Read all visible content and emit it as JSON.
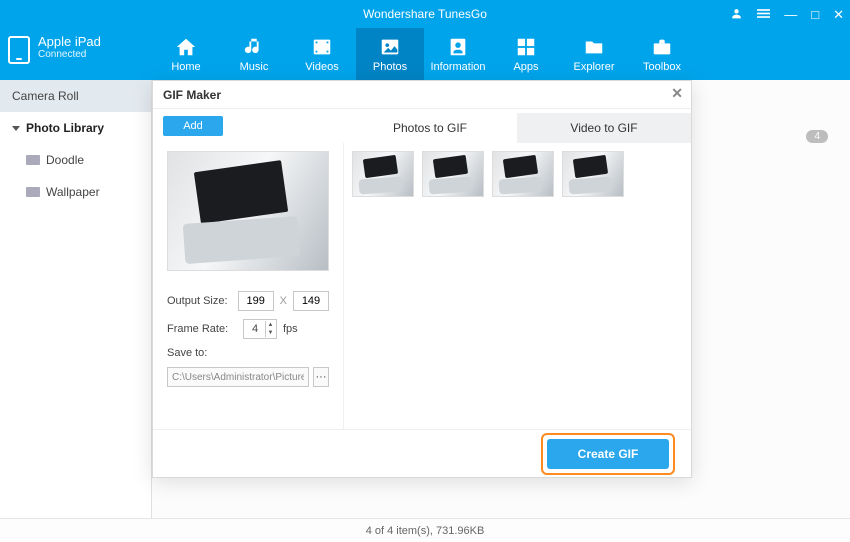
{
  "app": {
    "title": "Wondershare TunesGo"
  },
  "window_controls": {
    "user": "user-icon",
    "menu": "menu-icon",
    "min": "—",
    "max": "□",
    "close": "✕"
  },
  "device": {
    "name": "Apple iPad",
    "status": "Connected"
  },
  "nav": {
    "items": [
      {
        "key": "home",
        "label": "Home"
      },
      {
        "key": "music",
        "label": "Music"
      },
      {
        "key": "videos",
        "label": "Videos"
      },
      {
        "key": "photos",
        "label": "Photos",
        "active": true
      },
      {
        "key": "information",
        "label": "Information"
      },
      {
        "key": "apps",
        "label": "Apps"
      },
      {
        "key": "explorer",
        "label": "Explorer"
      },
      {
        "key": "toolbox",
        "label": "Toolbox"
      }
    ]
  },
  "sidebar": {
    "items": [
      {
        "label": "Camera Roll",
        "selected": true
      },
      {
        "label": "Photo Library",
        "header": true
      },
      {
        "label": "Doodle"
      },
      {
        "label": "Wallpaper"
      }
    ]
  },
  "badge_count": "4",
  "modal": {
    "title": "GIF Maker",
    "add_label": "Add",
    "tabs": [
      {
        "label": "Photos to GIF",
        "active": true
      },
      {
        "label": "Video to GIF"
      }
    ],
    "output_size_label": "Output Size:",
    "output_w": "199",
    "output_x": "X",
    "output_h": "149",
    "frame_rate_label": "Frame Rate:",
    "frame_rate": "4",
    "fps_label": "fps",
    "save_to_label": "Save to:",
    "save_path": "C:\\Users\\Administrator\\Pictures\\",
    "browse_label": "···",
    "close_label": "✕",
    "create_label": "Create GIF",
    "thumb_count": 4
  },
  "status": {
    "text": "4 of 4 item(s), 731.96KB"
  }
}
